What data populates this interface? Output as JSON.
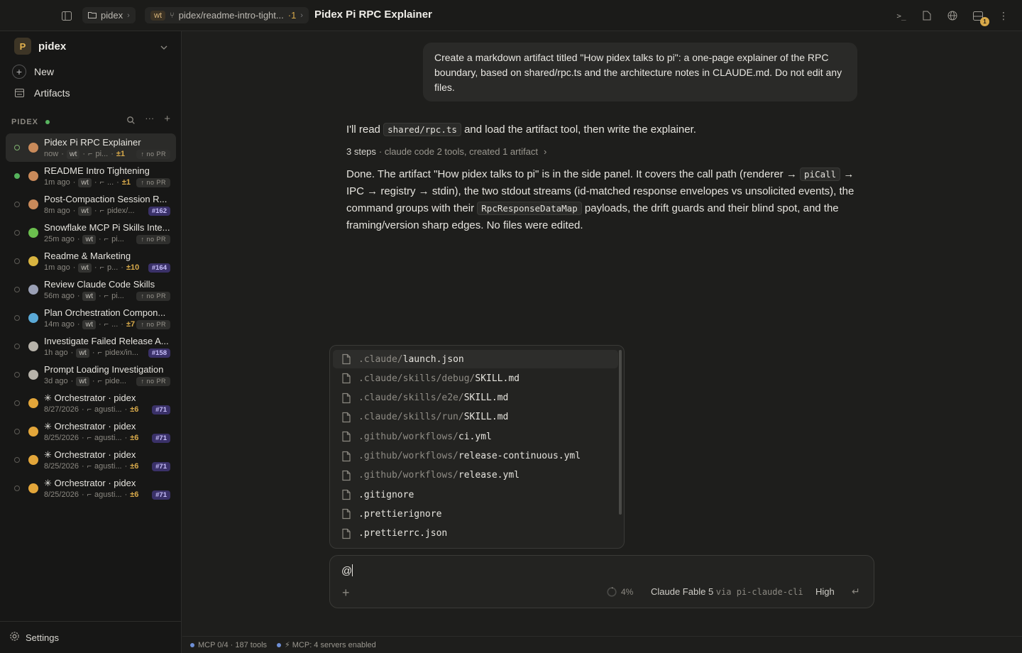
{
  "topbar": {
    "project_chip": "pidex",
    "branch_wt": "wt",
    "branch_name": "pidex/readme-intro-tight...",
    "branch_count": "·1",
    "title": "Pidex Pi RPC Explainer",
    "notif_count": "1"
  },
  "sidebar": {
    "workspace_initial": "P",
    "workspace_name": "pidex",
    "new_label": "New",
    "artifacts_label": "Artifacts",
    "section_label": "PIDEX",
    "settings_label": "Settings",
    "sessions": [
      {
        "title": "Pidex Pi RPC Explainer",
        "time": "now",
        "wt": "wt",
        "branch": "pi...",
        "diff": "±1",
        "pr": "↑ no PR"
      },
      {
        "title": "README Intro Tightening",
        "time": "1m ago",
        "wt": "wt",
        "branch": "...",
        "diff": "±1",
        "pr": "↑ no PR"
      },
      {
        "title": "Post-Compaction Session R...",
        "time": "8m ago",
        "wt": "wt",
        "branch": "pidex/...",
        "diff": "",
        "pr": "#162"
      },
      {
        "title": "Snowflake MCP Pi Skills Inte...",
        "time": "25m ago",
        "wt": "wt",
        "branch": "pi...",
        "diff": "",
        "pr": "↑ no PR"
      },
      {
        "title": "Readme & Marketing",
        "time": "1m ago",
        "wt": "wt",
        "branch": "p...",
        "diff": "±10",
        "pr": "#164"
      },
      {
        "title": "Review Claude Code Skills",
        "time": "56m ago",
        "wt": "wt",
        "branch": "pi...",
        "diff": "",
        "pr": "↑ no PR"
      },
      {
        "title": "Plan Orchestration Compon...",
        "time": "14m ago",
        "wt": "wt",
        "branch": "...",
        "diff": "±7",
        "pr": "↑ no PR"
      },
      {
        "title": "Investigate Failed Release A...",
        "time": "1h ago",
        "wt": "wt",
        "branch": "pidex/in...",
        "diff": "",
        "pr": "#158"
      },
      {
        "title": "Prompt Loading Investigation",
        "time": "3d ago",
        "wt": "wt",
        "branch": "pide...",
        "diff": "",
        "pr": "↑ no PR"
      },
      {
        "title": "✳ Orchestrator · pidex",
        "time": "8/27/2026",
        "wt": "",
        "branch": "agusti...",
        "diff": "±6",
        "pr": "#71"
      },
      {
        "title": "✳ Orchestrator · pidex",
        "time": "8/25/2026",
        "wt": "",
        "branch": "agusti...",
        "diff": "±6",
        "pr": "#71"
      },
      {
        "title": "✳ Orchestrator · pidex",
        "time": "8/25/2026",
        "wt": "",
        "branch": "agusti...",
        "diff": "±6",
        "pr": "#71"
      },
      {
        "title": "✳ Orchestrator · pidex",
        "time": "8/25/2026",
        "wt": "",
        "branch": "agusti...",
        "diff": "±6",
        "pr": "#71"
      }
    ]
  },
  "chat": {
    "user_message": "Create a markdown artifact titled \"How pidex talks to pi\": a one-page explainer of the RPC boundary, based on shared/rpc.ts and the architecture notes in CLAUDE.md. Do not edit any files.",
    "assistant_1_a": "I'll read",
    "assistant_1_code": "shared/rpc.ts",
    "assistant_1_b": "and load the artifact tool, then write the explainer.",
    "steps_count": "3 steps",
    "steps_detail": "· claude code 2 tools, created 1 artifact",
    "assistant_2_a": "Done. The artifact \"How pidex talks to pi\" is in the side panel. It covers the call path (renderer →",
    "assistant_2_code1": "piCall",
    "assistant_2_b": "→ IPC → registry → stdin), the two stdout streams (id-matched response envelopes vs unsolicited events), the command groups with their",
    "assistant_2_code2": "RpcResponseDataMap",
    "assistant_2_c": "payloads, the drift guards and their blind spot, and the framing/version sharp edges. No files were edited."
  },
  "file_picker": [
    {
      "dir": ".claude/",
      "file": "launch.json"
    },
    {
      "dir": ".claude/skills/debug/",
      "file": "SKILL.md"
    },
    {
      "dir": ".claude/skills/e2e/",
      "file": "SKILL.md"
    },
    {
      "dir": ".claude/skills/run/",
      "file": "SKILL.md"
    },
    {
      "dir": ".github/workflows/",
      "file": "ci.yml"
    },
    {
      "dir": ".github/workflows/",
      "file": "release-continuous.yml"
    },
    {
      "dir": ".github/workflows/",
      "file": "release.yml"
    },
    {
      "dir": "",
      "file": ".gitignore"
    },
    {
      "dir": "",
      "file": ".prettierignore"
    },
    {
      "dir": "",
      "file": ".prettierrc.json"
    }
  ],
  "composer": {
    "input_value": "@",
    "context_pct": "4%",
    "model": "Claude Fable 5",
    "via": "via pi-claude-cli",
    "effort": "High"
  },
  "statusbar": {
    "mcp_tools": "MCP 0/4 · 187 tools",
    "mcp_servers": "MCP: 4 servers enabled"
  },
  "colors": {
    "accent_gold": "#d7a94a",
    "pr_badge": "#3a3168",
    "active_dot": "#55b35c"
  }
}
